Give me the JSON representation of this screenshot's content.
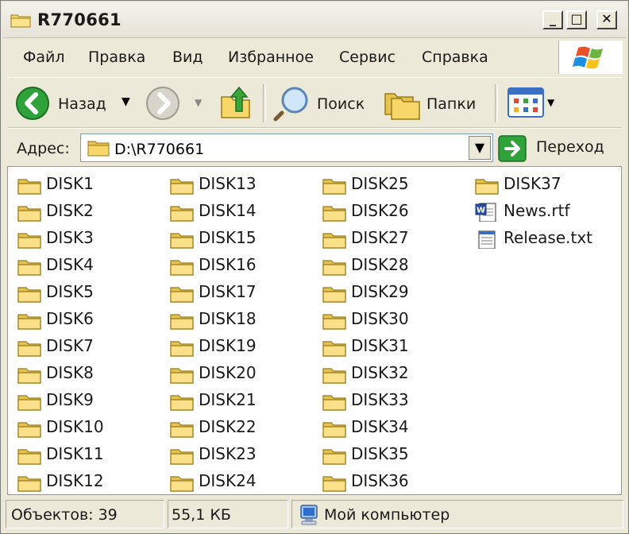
{
  "window": {
    "title": "R770661",
    "minimize": "_",
    "maximize": "□",
    "close": "✕"
  },
  "menu": [
    "Файл",
    "Правка",
    "Вид",
    "Избранное",
    "Сервис",
    "Справка"
  ],
  "toolbar": {
    "back_label": "Назад",
    "search_label": "Поиск",
    "folders_label": "Папки"
  },
  "address": {
    "label": "Адрес:",
    "value": "D:\\R770661",
    "go_label": "Переход"
  },
  "files": [
    {
      "name": "DISK1",
      "type": "folder"
    },
    {
      "name": "DISK2",
      "type": "folder"
    },
    {
      "name": "DISK3",
      "type": "folder"
    },
    {
      "name": "DISK4",
      "type": "folder"
    },
    {
      "name": "DISK5",
      "type": "folder"
    },
    {
      "name": "DISK6",
      "type": "folder"
    },
    {
      "name": "DISK7",
      "type": "folder"
    },
    {
      "name": "DISK8",
      "type": "folder"
    },
    {
      "name": "DISK9",
      "type": "folder"
    },
    {
      "name": "DISK10",
      "type": "folder"
    },
    {
      "name": "DISK11",
      "type": "folder"
    },
    {
      "name": "DISK12",
      "type": "folder"
    },
    {
      "name": "DISK13",
      "type": "folder"
    },
    {
      "name": "DISK14",
      "type": "folder"
    },
    {
      "name": "DISK15",
      "type": "folder"
    },
    {
      "name": "DISK16",
      "type": "folder"
    },
    {
      "name": "DISK17",
      "type": "folder"
    },
    {
      "name": "DISK18",
      "type": "folder"
    },
    {
      "name": "DISK19",
      "type": "folder"
    },
    {
      "name": "DISK20",
      "type": "folder"
    },
    {
      "name": "DISK21",
      "type": "folder"
    },
    {
      "name": "DISK22",
      "type": "folder"
    },
    {
      "name": "DISK23",
      "type": "folder"
    },
    {
      "name": "DISK24",
      "type": "folder"
    },
    {
      "name": "DISK25",
      "type": "folder"
    },
    {
      "name": "DISK26",
      "type": "folder"
    },
    {
      "name": "DISK27",
      "type": "folder"
    },
    {
      "name": "DISK28",
      "type": "folder"
    },
    {
      "name": "DISK29",
      "type": "folder"
    },
    {
      "name": "DISK30",
      "type": "folder"
    },
    {
      "name": "DISK31",
      "type": "folder"
    },
    {
      "name": "DISK32",
      "type": "folder"
    },
    {
      "name": "DISK33",
      "type": "folder"
    },
    {
      "name": "DISK34",
      "type": "folder"
    },
    {
      "name": "DISK35",
      "type": "folder"
    },
    {
      "name": "DISK36",
      "type": "folder"
    },
    {
      "name": "DISK37",
      "type": "folder"
    },
    {
      "name": "News.rtf",
      "type": "word-doc"
    },
    {
      "name": "Release.txt",
      "type": "text-doc"
    }
  ],
  "status": {
    "objects": "Объектов: 39",
    "size": "55,1 КБ",
    "location": "Мой компьютер"
  }
}
